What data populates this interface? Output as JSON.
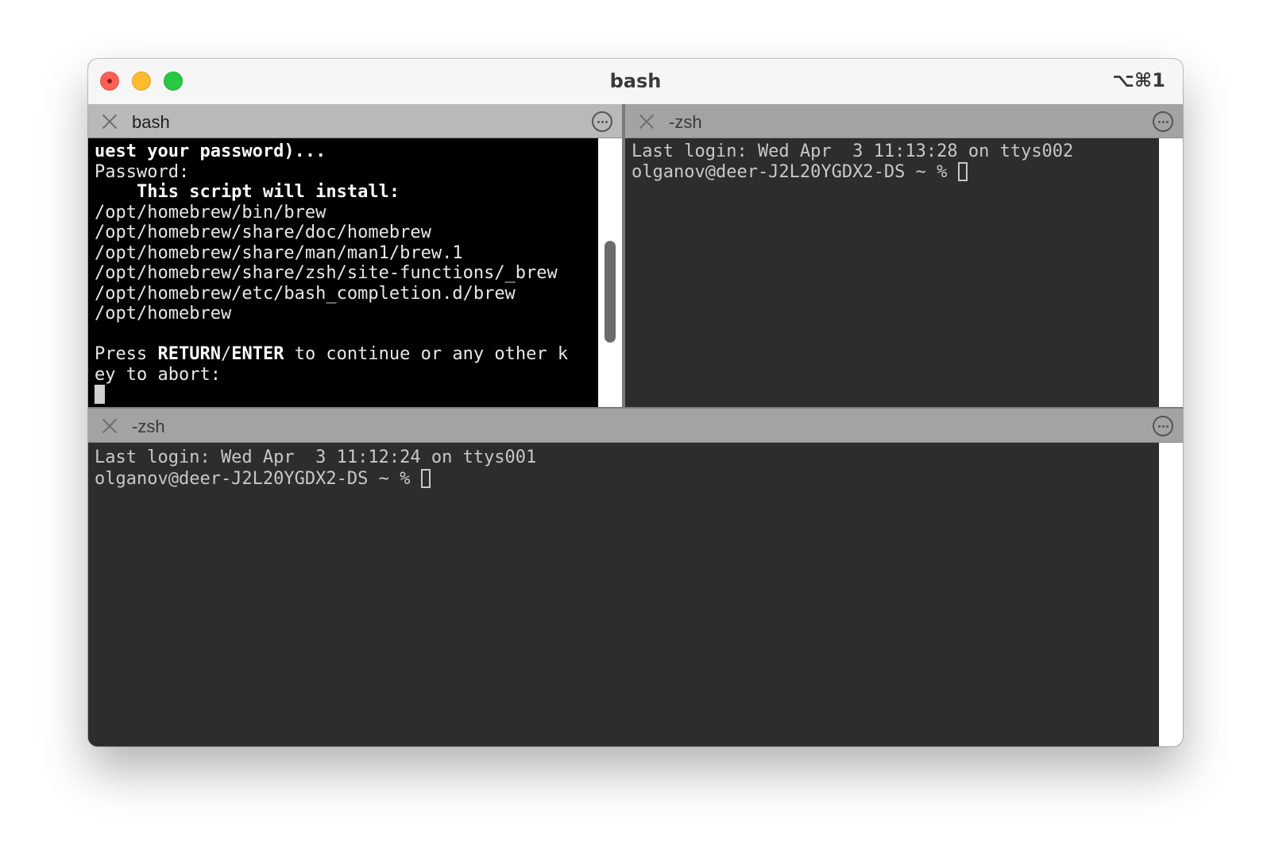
{
  "window": {
    "title": "bash",
    "shortcut": "⌥⌘1"
  },
  "panes": {
    "top_left": {
      "tab_title": "bash",
      "lines": [
        [
          {
            "t": "uest your password)...",
            "b": true
          }
        ],
        [
          {
            "t": "Password:",
            "b": false
          }
        ],
        [
          {
            "t": "    This script will install:",
            "b": true
          }
        ],
        [
          {
            "t": "/opt/homebrew/bin/brew",
            "b": false
          }
        ],
        [
          {
            "t": "/opt/homebrew/share/doc/homebrew",
            "b": false
          }
        ],
        [
          {
            "t": "/opt/homebrew/share/man/man1/brew.1",
            "b": false
          }
        ],
        [
          {
            "t": "/opt/homebrew/share/zsh/site-functions/_brew",
            "b": false
          }
        ],
        [
          {
            "t": "/opt/homebrew/etc/bash_completion.d/brew",
            "b": false
          }
        ],
        [
          {
            "t": "/opt/homebrew",
            "b": false
          }
        ],
        [
          {
            "t": "",
            "b": false
          }
        ],
        [
          {
            "t": "Press ",
            "b": false
          },
          {
            "t": "RETURN",
            "b": true
          },
          {
            "t": "/",
            "b": false
          },
          {
            "t": "ENTER",
            "b": true
          },
          {
            "t": " to continue or any other k",
            "b": false
          }
        ],
        [
          {
            "t": "ey to abort:",
            "b": false
          }
        ]
      ]
    },
    "top_right": {
      "tab_title": "-zsh",
      "login_line": "Last login: Wed Apr  3 11:13:28 on ttys002",
      "prompt": "olganov@deer-J2L20YGDX2-DS ~ % "
    },
    "bottom": {
      "tab_title": "-zsh",
      "login_line": "Last login: Wed Apr  3 11:12:24 on ttys001",
      "prompt": "olganov@deer-J2L20YGDX2-DS ~ % "
    }
  },
  "scroll": {
    "top_left_position": 0.62
  },
  "colors": {
    "close": "#fe5f57",
    "minimize": "#febc2e",
    "zoom": "#28c840",
    "bash_bg": "#000000",
    "zsh_bg": "#2d2d2d"
  },
  "icons": [
    "close-window-icon",
    "minimize-window-icon",
    "zoom-window-icon",
    "close-pane-icon",
    "more-options-icon"
  ]
}
